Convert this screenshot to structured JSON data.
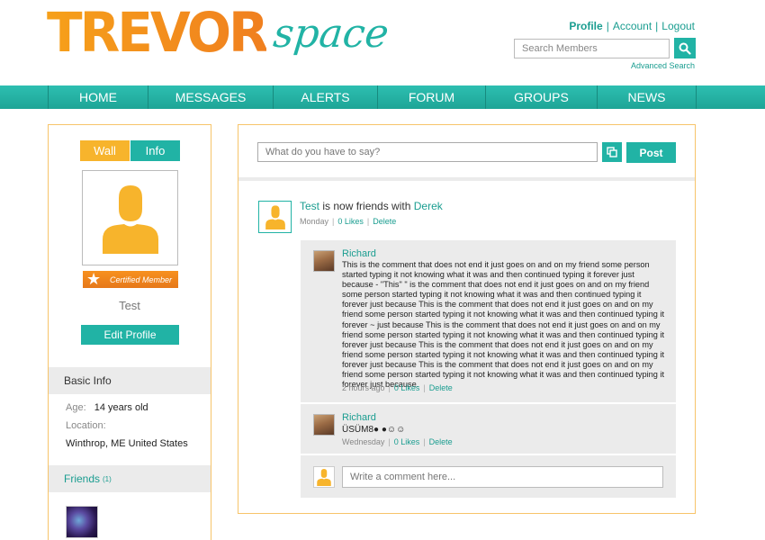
{
  "logo": {
    "main": "TREVOR",
    "sub": "space"
  },
  "toplinks": {
    "profile": "Profile",
    "account": "Account",
    "logout": "Logout",
    "sep": "|"
  },
  "search": {
    "placeholder": "Search Members",
    "advanced": "Advanced Search"
  },
  "nav": [
    "HOME",
    "MESSAGES",
    "ALERTS",
    "FORUM",
    "GROUPS",
    "NEWS"
  ],
  "sidebar": {
    "tabs": {
      "wall": "Wall",
      "info": "Info"
    },
    "certified": "Certified Member",
    "username": "Test",
    "edit_profile": "Edit Profile",
    "basic_info_title": "Basic Info",
    "age_label": "Age:",
    "age_value": "14 years old",
    "location_label": "Location:",
    "location_value": "Winthrop, ME United States",
    "friends_title": "Friends",
    "friends_count": "(1)"
  },
  "compose": {
    "placeholder": "What do you have to say?",
    "post_label": "Post"
  },
  "activity": {
    "actor": "Test",
    "action": "is now friends with",
    "target": "Derek",
    "time": "Monday",
    "likes": "0 Likes",
    "delete": "Delete",
    "sep": "|"
  },
  "comments": [
    {
      "author": "Richard",
      "text": "This is the comment that does not end it just goes on and on my friend some person started typing it not knowing what it was and then continued typing it forever just because - \"This\" \" is the comment that does not end it just goes on and on my friend some person started typing it not knowing what it was and then continued typing it forever just because This is the comment that does not end it just goes on and on my friend some person started typing it not knowing what it was and then continued typing it forever ~ just because This is the comment that does not end it just goes on and on my friend some person started typing it not knowing what it was and then continued typing it forever just because This is the comment that does not end it just goes on and on my friend some person started typing it not knowing what it was and then continued typing it forever just because This is the comment that does not end it just goes on and on my friend some person started typing it not knowing what it was and then continued typing it forever just because.",
      "time": "2 hours ago",
      "likes": "0 Likes",
      "delete": "Delete"
    },
    {
      "author": "Richard",
      "text": "ÜSÜM8● ●☺☺",
      "time": "Wednesday",
      "likes": "0 Likes",
      "delete": "Delete"
    }
  ],
  "reply": {
    "placeholder": "Write a comment here..."
  },
  "colors": {
    "teal": "#21b3a5",
    "orange": "#f7b42c",
    "border": "#f7c46a"
  },
  "icons": {
    "search": "search-icon",
    "compose": "attach-icon",
    "avatar": "user-silhouette-icon",
    "certified": "star-icon"
  }
}
